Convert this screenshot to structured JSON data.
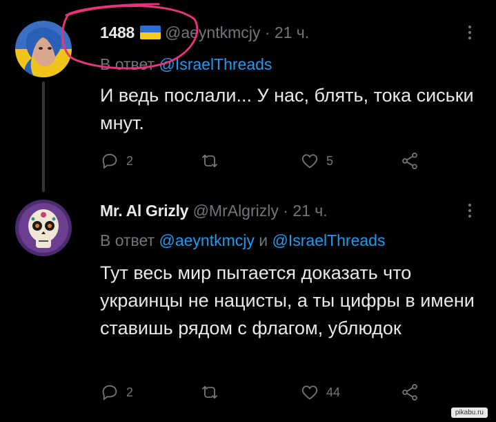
{
  "colors": {
    "background": "#000000",
    "text": "#e7e9ea",
    "muted": "#71767b",
    "link": "#1d9bf0",
    "annotation": "#e6337a"
  },
  "tweets": [
    {
      "name": "1488",
      "flag": "ukraine-flag",
      "handle": "@aeyntkmcjy",
      "dot": "·",
      "time": "21 ч.",
      "reply_prefix": "В ответ",
      "reply_to": "@IsraelThreads",
      "reply_and": "",
      "reply_to_2": "",
      "text": "И ведь послали... У нас, блять, тока сиськи мнут.",
      "reply_count": "2",
      "retweet_count": "",
      "like_count": "5"
    },
    {
      "name": "Mr. Al Grizly",
      "handle": "@MrAlgrizly",
      "dot": "·",
      "time": "21 ч.",
      "reply_prefix": "В ответ",
      "reply_to": "@aeyntkmcjy",
      "reply_and": "и",
      "reply_to_2": "@IsraelThreads",
      "text": "Тут весь мир пытается доказать что украинцы не нацисты, а ты цифры в имени ставишь рядом с флагом, ублюдок",
      "reply_count": "2",
      "retweet_count": "",
      "like_count": "44"
    }
  ],
  "watermark": "pikabu.ru"
}
